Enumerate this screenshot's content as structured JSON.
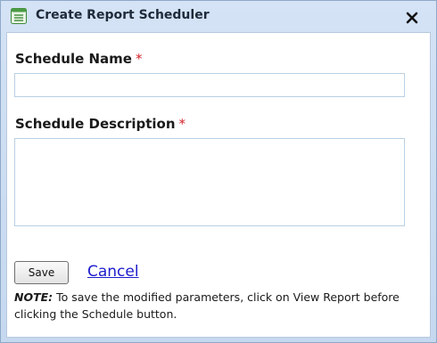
{
  "dialog": {
    "title": "Create Report Scheduler",
    "close_symbol": "x"
  },
  "form": {
    "name_label": "Schedule Name",
    "description_label": "Schedule Description",
    "required_marker": "*",
    "name_value": "",
    "description_value": ""
  },
  "actions": {
    "save_label": "Save",
    "cancel_label": "Cancel"
  },
  "note": {
    "label": "NOTE:",
    "text": " To save the modified parameters, click on View Report before clicking the Schedule button."
  },
  "colors": {
    "title_bar": "#d4e3f5",
    "required": "#d2232a",
    "link": "#1c1ccc",
    "field_border": "#b9d0e2"
  },
  "icons": {
    "title": "report-list-icon",
    "close": "close-icon"
  }
}
